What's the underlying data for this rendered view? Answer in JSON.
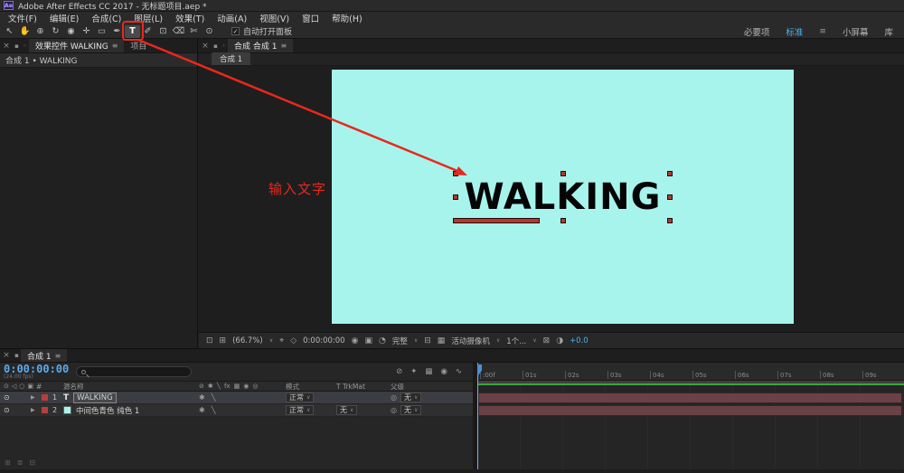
{
  "window": {
    "app_icon_text": "Ae",
    "title": "Adobe After Effects CC 2017 - 无标题项目.aep *"
  },
  "menubar": {
    "items": [
      "文件(F)",
      "编辑(E)",
      "合成(C)",
      "图层(L)",
      "效果(T)",
      "动画(A)",
      "视图(V)",
      "窗口",
      "帮助(H)"
    ]
  },
  "toolbar": {
    "tools": [
      {
        "name": "selection-tool",
        "glyph": "↖"
      },
      {
        "name": "hand-tool",
        "glyph": "✋"
      },
      {
        "name": "zoom-tool",
        "glyph": "⊕"
      },
      {
        "name": "orbit-camera-tool",
        "glyph": "↻"
      },
      {
        "name": "camera-tool",
        "glyph": "◉"
      },
      {
        "name": "pan-behind-tool",
        "glyph": "✛"
      },
      {
        "name": "shape-tool",
        "glyph": "▭"
      },
      {
        "name": "pen-tool",
        "glyph": "✒"
      },
      {
        "name": "text-tool",
        "glyph": "T"
      },
      {
        "name": "brush-tool",
        "glyph": "✐"
      },
      {
        "name": "clone-stamp-tool",
        "glyph": "⊡"
      },
      {
        "name": "eraser-tool",
        "glyph": "⌫"
      },
      {
        "name": "roto-brush-tool",
        "glyph": "✄"
      },
      {
        "name": "puppet-pin-tool",
        "glyph": "⊙"
      }
    ],
    "auto_open_panels_label": "自动打开面板",
    "workspaces": [
      {
        "label": "必要项"
      },
      {
        "label": "标准"
      },
      {
        "label": "小屏幕"
      },
      {
        "label": "库"
      }
    ],
    "active_workspace": "标准"
  },
  "effects_panel": {
    "tab_active": "效果控件 WALKING",
    "tab_project": "项目",
    "breadcrumb": "合成 1 • WALKING"
  },
  "comp_panel": {
    "tab": "合成 合成 1",
    "viewer_tab": "合成 1",
    "canvas_text": "WALKING",
    "statusbar": {
      "zoom": "(66.7%)",
      "timecode": "0:00:00:00",
      "resolution": "完整",
      "camera": "活动摄像机",
      "views": "1个...",
      "exposure": "+0.0"
    }
  },
  "annotation": {
    "note": "输入文字"
  },
  "timeline": {
    "tab": "合成 1",
    "timecode": "0:00:00:00",
    "framerate": "(24.00 fps)",
    "columns": {
      "num": "#",
      "source_name": "源名称",
      "mode": "模式",
      "trkmat": "T TrkMat",
      "parent": "父级"
    },
    "layers": [
      {
        "num": "1",
        "type_glyph": "T",
        "name": "WALKING",
        "mode": "正常",
        "trkmat": "",
        "parent": "无"
      },
      {
        "num": "2",
        "name": "中间色青色 纯色 1",
        "mode": "正常",
        "trkmat": "无",
        "parent": "无"
      }
    ],
    "ruler_labels": [
      ":00f",
      "01s",
      "02s",
      "03s",
      "04s",
      "05s",
      "06s",
      "07s",
      "08s",
      "09s"
    ],
    "mini_icons": [
      {
        "name": "hide-shy-layers-icon",
        "glyph": "⊘"
      },
      {
        "name": "draft-3d-icon",
        "glyph": "✦"
      },
      {
        "name": "frame-blending-icon",
        "glyph": "▦"
      },
      {
        "name": "motion-blur-icon",
        "glyph": "◉"
      },
      {
        "name": "graph-editor-icon",
        "glyph": "∿"
      }
    ],
    "bottom_icons": [
      {
        "name": "expand-layer-switches-icon",
        "glyph": "⊞"
      },
      {
        "name": "expand-transfer-controls-icon",
        "glyph": "≣"
      },
      {
        "name": "expand-time-controls-icon",
        "glyph": "⊟"
      }
    ]
  },
  "icons": {
    "close": "×",
    "menu": "≡",
    "panel": "▪",
    "lock": "◦",
    "dropdown": "∨",
    "eye": "⊙",
    "audio": "◁",
    "solo": "○",
    "lock_column": "▣",
    "expander": "▶",
    "pickwhip": "◎",
    "check": "✓",
    "quality": "╲",
    "collapse": "✱",
    "shy": "⊘",
    "frame_blend": "▦",
    "motion_blur": "◉",
    "threed": "◎",
    "fx": "fx"
  },
  "comp_status_icons": {
    "monitor": "⊡",
    "grid": "⊞",
    "ruler": "⌖",
    "mask": "◇",
    "snapshot": "◉",
    "show_snapshot": "▣",
    "channels": "◔",
    "roi": "⊟",
    "transparency": "▦",
    "flowchart": "⊠",
    "exposure_icon": "◑"
  },
  "colors": {
    "accent_blue": "#4fb0ee",
    "comp_cyan": "#a7f4ec",
    "annotation_red": "#e8281e",
    "layer_bar_maroon": "#6a4147",
    "cache_green": "#3da33d",
    "timecode_blue": "#5fa9e8",
    "label_red": "#b4403c"
  }
}
